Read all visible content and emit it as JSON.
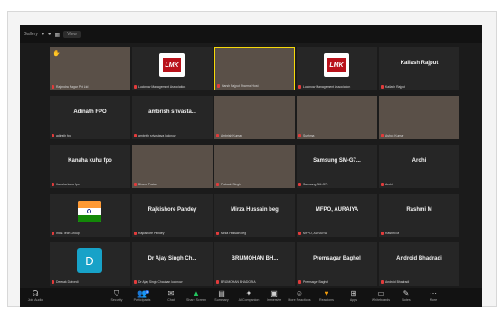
{
  "topbar": {
    "left_text": "Gallery",
    "icons": [
      "chevron-down-icon",
      "dot-icon",
      "grid-icon"
    ],
    "view_label": "View"
  },
  "tiles": [
    {
      "name": "",
      "caption": "Rajendra Nagar Pvt Ltd",
      "hand": true,
      "video": true
    },
    {
      "name": "LMK",
      "caption": "Lucknow Management Association",
      "logo": "lmk"
    },
    {
      "name": "",
      "caption": "Harsh Rajput Sharma Host",
      "video": true,
      "active": true
    },
    {
      "name": "LMK",
      "caption": "Lucknow Management Association",
      "logo": "lmk"
    },
    {
      "name": "Kailash Rajput",
      "caption": "Kailash Rajput"
    },
    {
      "name": "Adinath FPO",
      "caption": "adinath fpo"
    },
    {
      "name": "ambrish srivasta...",
      "caption": "ambrish srivastava lucknow"
    },
    {
      "name": "",
      "caption": "Ambrish Kumar",
      "video": true
    },
    {
      "name": "",
      "caption": "Sushma",
      "video": true
    },
    {
      "name": "",
      "caption": "Ashok Kumar",
      "video": true
    },
    {
      "name": "Kanaha kuhu fpo",
      "caption": "Kanaha kuhu fpo"
    },
    {
      "name": "",
      "caption": "Bhanu Pratap",
      "video": true
    },
    {
      "name": "",
      "caption": "Prakash Singh",
      "video": true
    },
    {
      "name": "Samsung SM-G7...",
      "caption": "Samsung SM-G7.."
    },
    {
      "name": "Arohi",
      "caption": "Arohi"
    },
    {
      "name": "",
      "caption": "India Tech Group",
      "logo": "flag"
    },
    {
      "name": "Rajkishore Pandey",
      "caption": "Rajkishore Pandey"
    },
    {
      "name": "Mirza Hussain beg",
      "caption": "Mirza Hussain beg"
    },
    {
      "name": "MFPO, AURAIYA",
      "caption": "MFPO, AURAIYA"
    },
    {
      "name": "Rashmi M",
      "caption": "Rashmi M"
    },
    {
      "name": "D",
      "caption": "Deepak Dwivedi",
      "avatar": true
    },
    {
      "name": "Dr Ajay Singh Ch...",
      "caption": "Dr Ajay Singh Chauhan lucknow"
    },
    {
      "name": "BRIJMOHAN BH...",
      "caption": "BRIJMOHAN BHADORIA"
    },
    {
      "name": "Premsagar Baghel",
      "caption": "Premsagar Baghel"
    },
    {
      "name": "Android Bhadradi",
      "caption": "Android Bhadradi"
    }
  ],
  "toolbar": {
    "items": [
      {
        "label": "Join Audio",
        "icon": "headphone-icon",
        "cls": ""
      },
      {
        "label": "Security",
        "icon": "shield-icon",
        "cls": ""
      },
      {
        "label": "Participants",
        "icon": "participants-icon",
        "cls": "",
        "badge": "44"
      },
      {
        "label": "Chat",
        "icon": "chat-icon",
        "cls": ""
      },
      {
        "label": "Share Screen",
        "icon": "share-screen-icon",
        "cls": "green"
      },
      {
        "label": "Summary",
        "icon": "summary-icon",
        "cls": ""
      },
      {
        "label": "AI Companion",
        "icon": "ai-companion-icon",
        "cls": ""
      },
      {
        "label": "Immersive",
        "icon": "immersive-icon",
        "cls": ""
      },
      {
        "label": "More Reactions",
        "icon": "reactions-icon",
        "cls": ""
      },
      {
        "label": "Reactions",
        "icon": "heart-icon",
        "cls": "orange"
      },
      {
        "label": "Apps",
        "icon": "apps-icon",
        "cls": ""
      },
      {
        "label": "Whiteboards",
        "icon": "whiteboard-icon",
        "cls": ""
      },
      {
        "label": "Notes",
        "icon": "notes-icon",
        "cls": ""
      },
      {
        "label": "More",
        "icon": "more-icon",
        "cls": ""
      }
    ]
  }
}
